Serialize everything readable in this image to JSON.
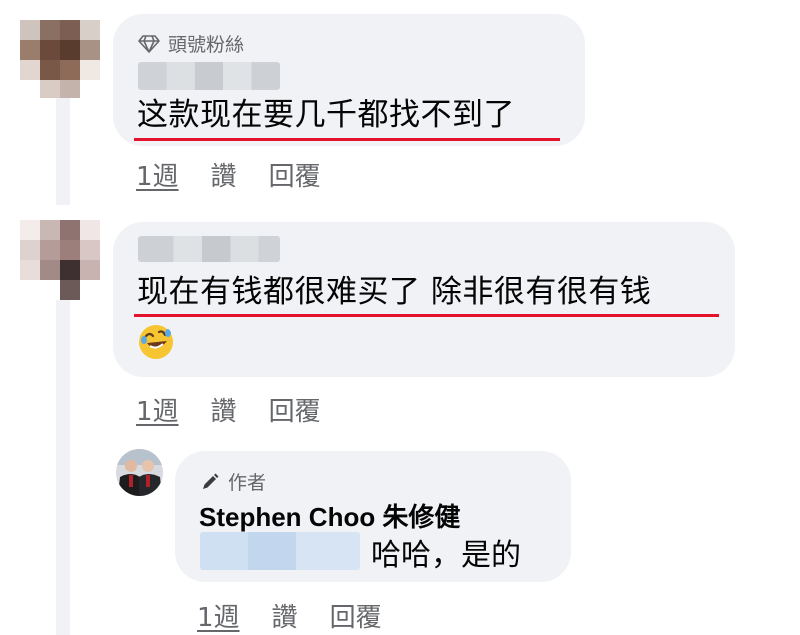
{
  "comments": [
    {
      "badge": "頭號粉絲",
      "badge_icon": "diamond-icon",
      "text": "这款现在要几千都找不到了",
      "actions": {
        "time": "1週",
        "like": "讚",
        "reply": "回覆"
      }
    },
    {
      "text": "现在有钱都很难买了 除非很有很有钱",
      "emoji": "rolling-on-floor-laughing-emoji",
      "actions": {
        "time": "1週",
        "like": "讚",
        "reply": "回覆"
      }
    }
  ],
  "reply": {
    "badge": "作者",
    "badge_icon": "pencil-icon",
    "author": "Stephen Choo 朱修健",
    "text": "哈哈，是的",
    "actions": {
      "time": "1週",
      "like": "讚",
      "reply": "回覆"
    }
  },
  "colors": {
    "bubble": "#f0f2f5",
    "underline": "#e4132b",
    "secondary_text": "#65676b"
  }
}
